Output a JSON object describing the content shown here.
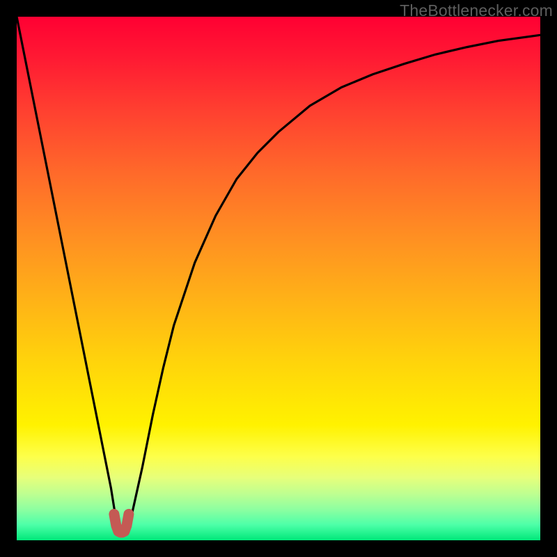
{
  "attribution": "TheBottlenecker.com",
  "chart_data": {
    "type": "line",
    "title": "",
    "xlabel": "",
    "ylabel": "",
    "xlim": [
      0,
      100
    ],
    "ylim": [
      0,
      100
    ],
    "series": [
      {
        "name": "bottleneck-curve",
        "x": [
          0,
          2,
          4,
          6,
          8,
          10,
          12,
          14,
          16,
          18,
          18.8,
          19.6,
          20.4,
          21.2,
          22,
          24,
          26,
          28,
          30,
          34,
          38,
          42,
          46,
          50,
          56,
          62,
          68,
          74,
          80,
          86,
          92,
          100
        ],
        "y": [
          100,
          90,
          80,
          70,
          60,
          50,
          40,
          30,
          20,
          10,
          5,
          2,
          1.5,
          2,
          5,
          14,
          24,
          33,
          41,
          53,
          62,
          69,
          74,
          78,
          83,
          86.5,
          89,
          91,
          92.8,
          94.2,
          95.4,
          96.5
        ]
      },
      {
        "name": "bottom-marker",
        "x": [
          18.6,
          19.0,
          19.4,
          19.8,
          20.2,
          20.6,
          21.0,
          21.4
        ],
        "y": [
          5.0,
          2.8,
          1.7,
          1.5,
          1.5,
          1.7,
          2.8,
          5.0
        ]
      }
    ],
    "gradient_stops": [
      {
        "pos": 0,
        "color": "#ff0033"
      },
      {
        "pos": 18,
        "color": "#ff4030"
      },
      {
        "pos": 42,
        "color": "#ff8f22"
      },
      {
        "pos": 66,
        "color": "#ffd40b"
      },
      {
        "pos": 84,
        "color": "#fdff4a"
      },
      {
        "pos": 94,
        "color": "#8fffa0"
      },
      {
        "pos": 100,
        "color": "#00e87a"
      }
    ],
    "marker_color": "#c45a54"
  }
}
